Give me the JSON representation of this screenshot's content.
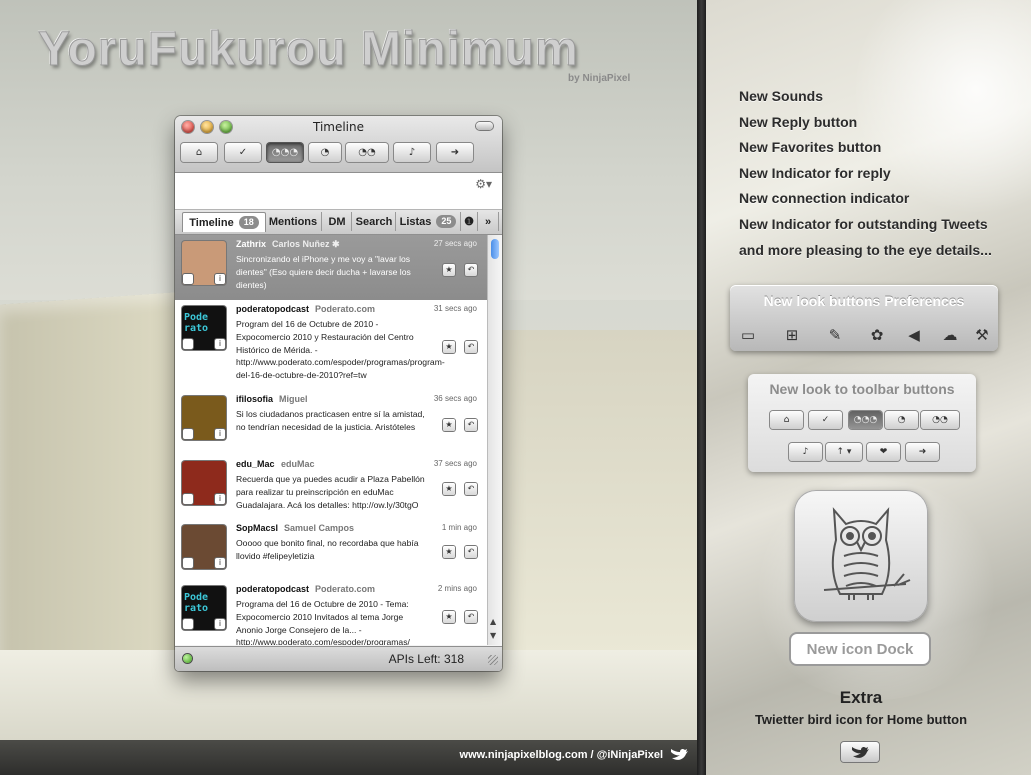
{
  "banner": {
    "title": "YoruFukurou Minimum",
    "byline": "by NinjaPixel",
    "footer": "www.ninjapixelblog.com / @iNinjaPixel"
  },
  "window": {
    "title": "Timeline",
    "toolbar": [
      {
        "name": "home-icon",
        "glyph": "⌂",
        "active": false
      },
      {
        "name": "check-icon",
        "glyph": "✓",
        "active": false
      },
      {
        "name": "speech-triple-icon",
        "glyph": "◔◔◔",
        "active": true
      },
      {
        "name": "speech-single-icon",
        "glyph": "◔",
        "active": false
      },
      {
        "name": "speech-double-icon",
        "glyph": "◔◔",
        "active": false
      },
      {
        "name": "sound-icon",
        "glyph": "♪",
        "active": false
      },
      {
        "name": "arrow-right-icon",
        "glyph": "➜",
        "active": false
      }
    ],
    "tabs": [
      {
        "label": "Timeline",
        "badge": "18",
        "active": true
      },
      {
        "label": "Mentions",
        "badge": "",
        "active": false
      },
      {
        "label": "DM",
        "badge": "",
        "active": false
      },
      {
        "label": "Search",
        "badge": "",
        "active": false
      },
      {
        "label": "Listas",
        "badge": "25",
        "active": false
      },
      {
        "label": "❶",
        "badge": "",
        "active": false
      },
      {
        "label": "»",
        "badge": "",
        "active": false
      }
    ],
    "tweets": [
      {
        "user": "Zathrix",
        "real": "Carlos Nuñez ✱",
        "time": "27 secs ago",
        "text": "Sincronizando el iPhone y me voy a \"lavar los dientes\" (Eso quiere decir ducha + lavarse los dientes)",
        "selected": true,
        "avatar_color": "#c99a78"
      },
      {
        "user": "poderatopodcast",
        "real": "Poderato.com",
        "time": "31 secs ago",
        "text": "Program del 16 de Octubre de 2010 - Expocomercio 2010 y Restauración del Centro Histórico de Mérida. - http://www.poderato.com/espoder/programas/program-del-16-de-octubre-de-2010?ref=tw",
        "selected": false,
        "avatar_color": "#111111"
      },
      {
        "user": "ifilosofia",
        "real": "Miguel",
        "time": "36 secs ago",
        "text": "Si los ciudadanos practicasen entre sí la amistad, no tendrían necesidad de la justicia. Aristóteles",
        "selected": false,
        "avatar_color": "#7a5a1c"
      },
      {
        "user": "edu_Mac",
        "real": "eduMac",
        "time": "37 secs ago",
        "text": "Recuerda que ya puedes acudir a Plaza Pabellón para realizar tu preinscripción en eduMac Guadalajara. Acá los detalles: http://ow.ly/30tgO",
        "selected": false,
        "avatar_color": "#8e2a1c"
      },
      {
        "user": "SopMacsl",
        "real": "Samuel Campos",
        "time": "1 min ago",
        "text": "Ooooo que bonito final, no recordaba que había llovido #felipeyletizia",
        "selected": false,
        "avatar_color": "#6b4a33"
      },
      {
        "user": "poderatopodcast",
        "real": "Poderato.com",
        "time": "2 mins ago",
        "text": "Programa del 16 de Octubre de 2010 - Tema: Expocomercio 2010 Invitados al tema Jorge Anonio Jorge Consejero de la... - http://www.poderato.com/espoder/programas/",
        "selected": false,
        "avatar_color": "#111111"
      }
    ],
    "avatar_logo_text": "Pode rato",
    "status": {
      "apis": "APIs Left: 318"
    }
  },
  "features": [
    "New Sounds",
    "New Reply button",
    "New Favorites button",
    "New Indicator for reply",
    "New connection indicator",
    "New Indicator for outstanding Tweets",
    "and more pleasing to the eye details..."
  ],
  "prefs": {
    "title": "New look buttons Preferences",
    "icons": [
      {
        "name": "window-icon",
        "glyph": "▭"
      },
      {
        "name": "new-tab-icon",
        "glyph": "⊞"
      },
      {
        "name": "pen-icon",
        "glyph": "✎"
      },
      {
        "name": "palette-icon",
        "glyph": "✿"
      },
      {
        "name": "speaker-icon",
        "glyph": "◀"
      },
      {
        "name": "bird-icon",
        "glyph": "☁"
      },
      {
        "name": "brush-icon",
        "glyph": "⚒"
      }
    ]
  },
  "toolbar_panel": {
    "title": "New look to toolbar buttons",
    "row1": [
      {
        "name": "home-icon",
        "glyph": "⌂",
        "active": false
      },
      {
        "name": "check-icon",
        "glyph": "✓",
        "active": false
      },
      {
        "name": "speech-triple-icon",
        "glyph": "◔◔◔",
        "active": true
      },
      {
        "name": "speech-single-icon",
        "glyph": "◔",
        "active": false
      },
      {
        "name": "speech-double-icon",
        "glyph": "◔◔",
        "active": false
      }
    ],
    "row2": [
      {
        "name": "sound-icon",
        "glyph": "♪",
        "active": false
      },
      {
        "name": "arrow-up-dropdown-icon",
        "glyph": "↑ ▾",
        "active": false
      },
      {
        "name": "heart-icon",
        "glyph": "❤",
        "active": false
      },
      {
        "name": "arrow-right-icon",
        "glyph": "➜",
        "active": false
      }
    ]
  },
  "dock": {
    "label": "New icon Dock"
  },
  "extra": {
    "title": "Extra",
    "text": "Twietter bird icon for Home button"
  },
  "colors": {
    "accent": "#3d82e6",
    "selected_row": "#939393",
    "panel": "#c8c8c8"
  }
}
